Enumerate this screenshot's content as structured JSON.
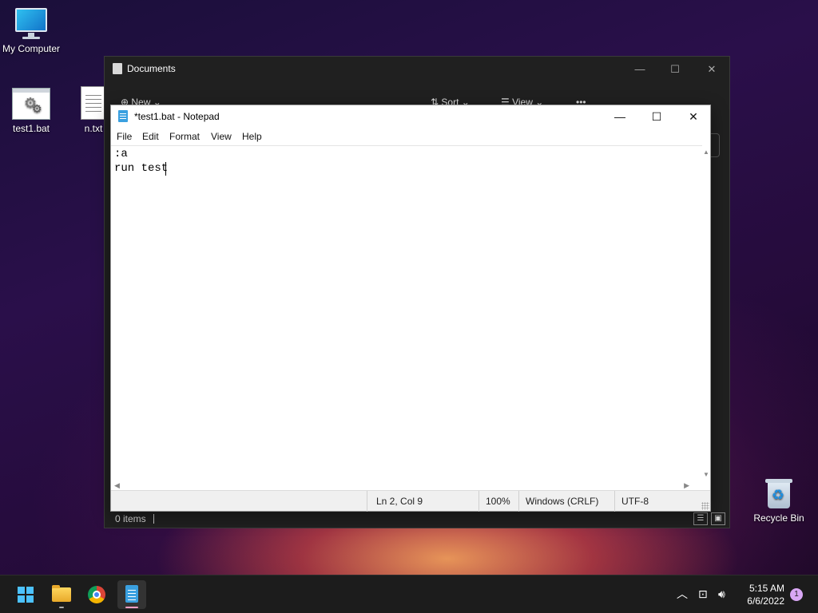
{
  "desktop": {
    "icons": [
      {
        "label": "My Computer"
      },
      {
        "label": "test1.bat"
      },
      {
        "label": "n.txt"
      },
      {
        "label": "Recycle Bin"
      }
    ]
  },
  "explorer": {
    "title": "Documents",
    "toolbar": {
      "new_label": "New",
      "sort_label": "Sort",
      "view_label": "View",
      "more_label": "•••"
    },
    "status": "0 items"
  },
  "notepad": {
    "title": "*test1.bat - Notepad",
    "menu": [
      "File",
      "Edit",
      "Format",
      "View",
      "Help"
    ],
    "lines": [
      ":a",
      "run test"
    ],
    "status": {
      "position": "Ln 2, Col 9",
      "zoom": "100%",
      "line_ending": "Windows (CRLF)",
      "encoding": "UTF-8"
    }
  },
  "taskbar": {
    "clock_time": "5:15 AM",
    "clock_date": "6/6/2022",
    "notification_count": "1"
  },
  "colors": {
    "accent": "#4cc2ff",
    "taskbar_bg": "#1c1c1c",
    "notification_badge": "#d9a7f5"
  }
}
